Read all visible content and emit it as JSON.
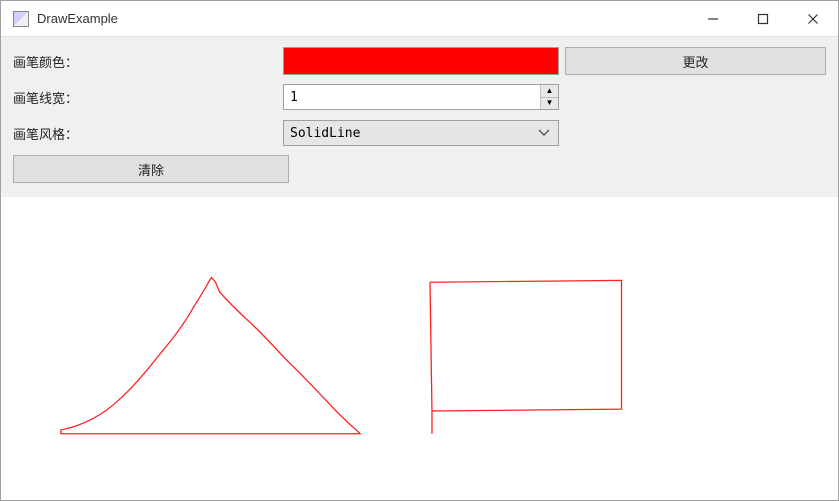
{
  "window": {
    "title": "DrawExample"
  },
  "labels": {
    "pen_color": "画笔颜色：",
    "pen_width": "画笔线宽：",
    "pen_style": "画笔风格："
  },
  "fields": {
    "color": "#ff0000",
    "width_value": "1",
    "style_value": "SolidLine"
  },
  "buttons": {
    "change": "更改",
    "clear": "清除"
  },
  "controls": {
    "minimize": "—",
    "close": "✕"
  }
}
